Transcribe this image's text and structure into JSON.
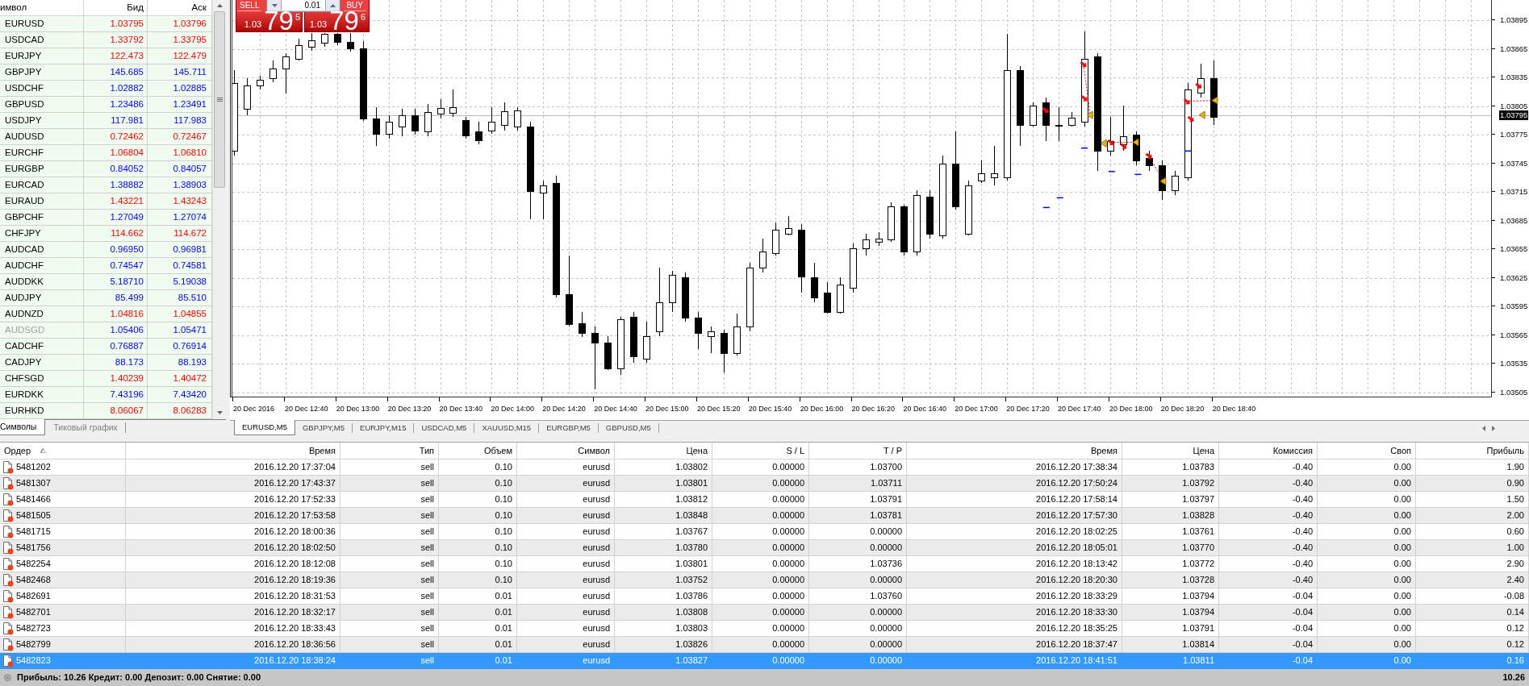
{
  "market_watch": {
    "columns": [
      "имвол",
      "Бид",
      "Аск"
    ],
    "rows": [
      {
        "symbol": "EURUSD",
        "bid": "1.03795",
        "ask": "1.03796",
        "color": "#ff0000",
        "disabled": false
      },
      {
        "symbol": "USDCAD",
        "bid": "1.33792",
        "ask": "1.33795",
        "color": "#ff0000",
        "disabled": false
      },
      {
        "symbol": "EURJPY",
        "bid": "122.473",
        "ask": "122.479",
        "color": "#ff0000",
        "disabled": false
      },
      {
        "symbol": "GBPJPY",
        "bid": "145.685",
        "ask": "145.711",
        "color": "#0000ff",
        "disabled": false
      },
      {
        "symbol": "USDCHF",
        "bid": "1.02882",
        "ask": "1.02885",
        "color": "#0000ff",
        "disabled": false
      },
      {
        "symbol": "GBPUSD",
        "bid": "1.23486",
        "ask": "1.23491",
        "color": "#0000ff",
        "disabled": false
      },
      {
        "symbol": "USDJPY",
        "bid": "117.981",
        "ask": "117.983",
        "color": "#0000ff",
        "disabled": false
      },
      {
        "symbol": "AUDUSD",
        "bid": "0.72462",
        "ask": "0.72467",
        "color": "#ff0000",
        "disabled": false
      },
      {
        "symbol": "EURCHF",
        "bid": "1.06804",
        "ask": "1.06810",
        "color": "#ff0000",
        "disabled": false
      },
      {
        "symbol": "EURGBP",
        "bid": "0.84052",
        "ask": "0.84057",
        "color": "#0000ff",
        "disabled": false
      },
      {
        "symbol": "EURCAD",
        "bid": "1.38882",
        "ask": "1.38903",
        "color": "#0000ff",
        "disabled": false
      },
      {
        "symbol": "EURAUD",
        "bid": "1.43221",
        "ask": "1.43243",
        "color": "#ff0000",
        "disabled": false
      },
      {
        "symbol": "GBPCHF",
        "bid": "1.27049",
        "ask": "1.27074",
        "color": "#0000ff",
        "disabled": false
      },
      {
        "symbol": "CHFJPY",
        "bid": "114.662",
        "ask": "114.672",
        "color": "#ff0000",
        "disabled": false
      },
      {
        "symbol": "AUDCAD",
        "bid": "0.96950",
        "ask": "0.96981",
        "color": "#0000ff",
        "disabled": false
      },
      {
        "symbol": "AUDCHF",
        "bid": "0.74547",
        "ask": "0.74581",
        "color": "#0000ff",
        "disabled": false
      },
      {
        "symbol": "AUDDKK",
        "bid": "5.18710",
        "ask": "5.19038",
        "color": "#0000ff",
        "disabled": false
      },
      {
        "symbol": "AUDJPY",
        "bid": "85.499",
        "ask": "85.510",
        "color": "#0000ff",
        "disabled": false
      },
      {
        "symbol": "AUDNZD",
        "bid": "1.04816",
        "ask": "1.04855",
        "color": "#ff0000",
        "disabled": false
      },
      {
        "symbol": "AUDSGD",
        "bid": "1.05406",
        "ask": "1.05471",
        "color": "#0000ff",
        "disabled": true
      },
      {
        "symbol": "CADCHF",
        "bid": "0.76887",
        "ask": "0.76914",
        "color": "#0000ff",
        "disabled": false
      },
      {
        "symbol": "CADJPY",
        "bid": "88.173",
        "ask": "88.193",
        "color": "#0000ff",
        "disabled": false
      },
      {
        "symbol": "CHFSGD",
        "bid": "1.40239",
        "ask": "1.40472",
        "color": "#ff0000",
        "disabled": false
      },
      {
        "symbol": "EURDKK",
        "bid": "7.43196",
        "ask": "7.43420",
        "color": "#0000ff",
        "disabled": false
      },
      {
        "symbol": "EURHKD",
        "bid": "8.06067",
        "ask": "8.06283",
        "color": "#ff0000",
        "disabled": false
      }
    ],
    "tabs": [
      {
        "label": "Символы",
        "selected": true
      },
      {
        "label": "Тиковый график",
        "selected": false
      }
    ]
  },
  "one_click": {
    "sell": {
      "label": "SELL",
      "prefix": "1.03",
      "big": "79",
      "small": "5"
    },
    "volume": "0.01",
    "buy": {
      "label": "BUY",
      "prefix": "1.03",
      "big": "79",
      "small": "6"
    }
  },
  "chart": {
    "current_price": "1.03795",
    "price_axis": [
      "1.03895",
      "1.03865",
      "1.03835",
      "1.03805",
      "1.03775",
      "1.03745",
      "1.03715",
      "1.03685",
      "1.03655",
      "1.03625",
      "1.03595",
      "1.03565",
      "1.03535",
      "1.03505"
    ],
    "time_axis": [
      "20 Dec 2016",
      "20 Dec 12:40",
      "20 Dec 13:00",
      "20 Dec 13:20",
      "20 Dec 13:40",
      "20 Dec 14:00",
      "20 Dec 14:20",
      "20 Dec 14:40",
      "20 Dec 15:00",
      "20 Dec 15:20",
      "20 Dec 15:40",
      "20 Dec 16:00",
      "20 Dec 16:20",
      "20 Dec 16:40",
      "20 Dec 17:00",
      "20 Dec 17:20",
      "20 Dec 17:40",
      "20 Dec 18:00",
      "20 Dec 18:20",
      "20 Dec 18:40"
    ],
    "tabs": [
      {
        "label": "EURUSD,M5",
        "selected": true
      },
      {
        "label": "GBPJPY,M5",
        "selected": false
      },
      {
        "label": "EURJPY,M15",
        "selected": false
      },
      {
        "label": "USDCAD,M5",
        "selected": false
      },
      {
        "label": "XAUUSD,M15",
        "selected": false
      },
      {
        "label": "EURGBP,M5",
        "selected": false
      },
      {
        "label": "GBPUSD,M5",
        "selected": false
      }
    ]
  },
  "terminal": {
    "columns": [
      {
        "label": "Ордер",
        "sorted": true
      },
      {
        "label": "Время",
        "sorted": false
      },
      {
        "label": "Тип",
        "sorted": false
      },
      {
        "label": "Объем",
        "sorted": false
      },
      {
        "label": "Символ",
        "sorted": false
      },
      {
        "label": "Цена",
        "sorted": false
      },
      {
        "label": "S / L",
        "sorted": false
      },
      {
        "label": "T / P",
        "sorted": false
      },
      {
        "label": "Время",
        "sorted": false
      },
      {
        "label": "Цена",
        "sorted": false
      },
      {
        "label": "Комиссия",
        "sorted": false
      },
      {
        "label": "Своп",
        "sorted": false
      },
      {
        "label": "Прибыль",
        "sorted": false
      }
    ],
    "rows": [
      {
        "cells": [
          "5481202",
          "2016.12.20 17:37:04",
          "sell",
          "0.10",
          "eurusd",
          "1.03802",
          "0.00000",
          "1.03700",
          "2016.12.20 17:38:34",
          "1.03783",
          "-0.40",
          "0.00",
          "1.90"
        ],
        "selected": false
      },
      {
        "cells": [
          "5481307",
          "2016.12.20 17:43:37",
          "sell",
          "0.10",
          "eurusd",
          "1.03801",
          "0.00000",
          "1.03711",
          "2016.12.20 17:50:24",
          "1.03792",
          "-0.40",
          "0.00",
          "0.90"
        ],
        "selected": false
      },
      {
        "cells": [
          "5481466",
          "2016.12.20 17:52:33",
          "sell",
          "0.10",
          "eurusd",
          "1.03812",
          "0.00000",
          "1.03791",
          "2016.12.20 17:58:14",
          "1.03797",
          "-0.40",
          "0.00",
          "1.50"
        ],
        "selected": false
      },
      {
        "cells": [
          "5481505",
          "2016.12.20 17:53:58",
          "sell",
          "0.10",
          "eurusd",
          "1.03848",
          "0.00000",
          "1.03781",
          "2016.12.20 17:57:30",
          "1.03828",
          "-0.40",
          "0.00",
          "2.00"
        ],
        "selected": false
      },
      {
        "cells": [
          "5481715",
          "2016.12.20 18:00:36",
          "sell",
          "0.10",
          "eurusd",
          "1.03767",
          "0.00000",
          "0.00000",
          "2016.12.20 18:02:25",
          "1.03761",
          "-0.40",
          "0.00",
          "0.60"
        ],
        "selected": false
      },
      {
        "cells": [
          "5481756",
          "2016.12.20 18:02:50",
          "sell",
          "0.10",
          "eurusd",
          "1.03780",
          "0.00000",
          "0.00000",
          "2016.12.20 18:05:01",
          "1.03770",
          "-0.40",
          "0.00",
          "1.00"
        ],
        "selected": false
      },
      {
        "cells": [
          "5482254",
          "2016.12.20 18:12:08",
          "sell",
          "0.10",
          "eurusd",
          "1.03801",
          "0.00000",
          "1.03736",
          "2016.12.20 18:13:42",
          "1.03772",
          "-0.40",
          "0.00",
          "2.90"
        ],
        "selected": false
      },
      {
        "cells": [
          "5482468",
          "2016.12.20 18:19:36",
          "sell",
          "0.10",
          "eurusd",
          "1.03752",
          "0.00000",
          "0.00000",
          "2016.12.20 18:20:30",
          "1.03728",
          "-0.40",
          "0.00",
          "2.40"
        ],
        "selected": false
      },
      {
        "cells": [
          "5482691",
          "2016.12.20 18:31:53",
          "sell",
          "0.01",
          "eurusd",
          "1.03786",
          "0.00000",
          "1.03760",
          "2016.12.20 18:33:29",
          "1.03794",
          "-0.04",
          "0.00",
          "-0.08"
        ],
        "selected": false
      },
      {
        "cells": [
          "5482701",
          "2016.12.20 18:32:17",
          "sell",
          "0.01",
          "eurusd",
          "1.03808",
          "0.00000",
          "0.00000",
          "2016.12.20 18:33:30",
          "1.03794",
          "-0.04",
          "0.00",
          "0.14"
        ],
        "selected": false
      },
      {
        "cells": [
          "5482723",
          "2016.12.20 18:33:43",
          "sell",
          "0.01",
          "eurusd",
          "1.03803",
          "0.00000",
          "0.00000",
          "2016.12.20 18:35:25",
          "1.03791",
          "-0.04",
          "0.00",
          "0.12"
        ],
        "selected": false
      },
      {
        "cells": [
          "5482799",
          "2016.12.20 18:36:56",
          "sell",
          "0.01",
          "eurusd",
          "1.03826",
          "0.00000",
          "0.00000",
          "2016.12.20 18:37:47",
          "1.03814",
          "-0.04",
          "0.00",
          "0.12"
        ],
        "selected": false
      },
      {
        "cells": [
          "5482823",
          "2016.12.20 18:38:24",
          "sell",
          "0.01",
          "eurusd",
          "1.03827",
          "0.00000",
          "0.00000",
          "2016.12.20 18:41:51",
          "1.03811",
          "-0.04",
          "0.00",
          "0.16"
        ],
        "selected": true
      }
    ]
  },
  "status_bar": {
    "summary": "Прибыль: 10.26 Кредит: 0.00 Депозит: 0.00 Снятие: 0.00",
    "total": "10.26"
  }
}
